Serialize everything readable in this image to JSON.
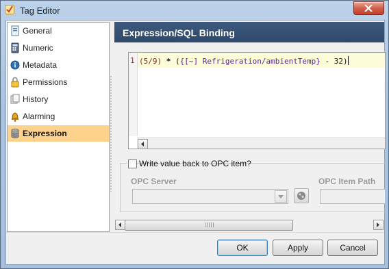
{
  "window": {
    "title": "Tag Editor"
  },
  "nav": {
    "items": [
      {
        "label": "General",
        "icon": "document-info-icon"
      },
      {
        "label": "Numeric",
        "icon": "calculator-icon"
      },
      {
        "label": "Metadata",
        "icon": "info-icon"
      },
      {
        "label": "Permissions",
        "icon": "lock-icon"
      },
      {
        "label": "History",
        "icon": "history-icon"
      },
      {
        "label": "Alarming",
        "icon": "bell-icon"
      },
      {
        "label": "Expression",
        "icon": "database-icon"
      }
    ],
    "selected": "Expression"
  },
  "panel": {
    "title": "Expression/SQL Binding",
    "editor": {
      "line_number": "1",
      "tokens": {
        "open": "(5/9)",
        "op": " * ",
        "paren_open": "(",
        "tag": "{[~] Refrigeration/ambientTemp}",
        "rest": " - 32)"
      }
    },
    "opc": {
      "write_back_label": "Write value back to OPC item?",
      "write_back_checked": false,
      "server_label": "OPC Server",
      "server_value": "",
      "item_path_label": "OPC Item Path",
      "item_path_value": ""
    }
  },
  "buttons": {
    "ok": "OK",
    "apply": "Apply",
    "cancel": "Cancel"
  },
  "colors": {
    "header_bg": "#2e4869",
    "selected_bg": "#fcd28c",
    "current_line_bg": "#fcfcd8"
  }
}
